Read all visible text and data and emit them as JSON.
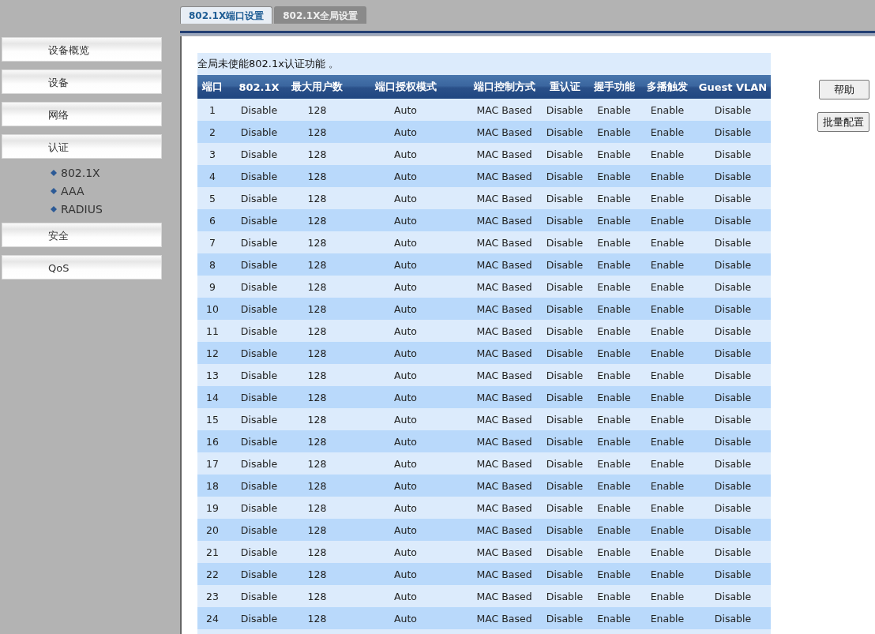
{
  "sidebar": {
    "items": [
      {
        "label": "设备概览"
      },
      {
        "label": "设备"
      },
      {
        "label": "网络"
      },
      {
        "label": "认证",
        "children": [
          {
            "label": "802.1X"
          },
          {
            "label": "AAA"
          },
          {
            "label": "RADIUS"
          }
        ]
      },
      {
        "label": "安全"
      },
      {
        "label": "QoS"
      }
    ]
  },
  "tabs": [
    {
      "label": "802.1X端口设置",
      "selected": true
    },
    {
      "label": "802.1X全局设置",
      "selected": false
    }
  ],
  "notice": "全局未使能802.1x认证功能 。",
  "table": {
    "columns": [
      "端口",
      "802.1X",
      "最大用户数",
      "端口授权模式",
      "端口控制方式",
      "重认证",
      "握手功能",
      "多播触发",
      "Guest VLAN"
    ],
    "rows": [
      [
        "1",
        "Disable",
        "128",
        "Auto",
        "MAC Based",
        "Disable",
        "Enable",
        "Enable",
        "Disable"
      ],
      [
        "2",
        "Disable",
        "128",
        "Auto",
        "MAC Based",
        "Disable",
        "Enable",
        "Enable",
        "Disable"
      ],
      [
        "3",
        "Disable",
        "128",
        "Auto",
        "MAC Based",
        "Disable",
        "Enable",
        "Enable",
        "Disable"
      ],
      [
        "4",
        "Disable",
        "128",
        "Auto",
        "MAC Based",
        "Disable",
        "Enable",
        "Enable",
        "Disable"
      ],
      [
        "5",
        "Disable",
        "128",
        "Auto",
        "MAC Based",
        "Disable",
        "Enable",
        "Enable",
        "Disable"
      ],
      [
        "6",
        "Disable",
        "128",
        "Auto",
        "MAC Based",
        "Disable",
        "Enable",
        "Enable",
        "Disable"
      ],
      [
        "7",
        "Disable",
        "128",
        "Auto",
        "MAC Based",
        "Disable",
        "Enable",
        "Enable",
        "Disable"
      ],
      [
        "8",
        "Disable",
        "128",
        "Auto",
        "MAC Based",
        "Disable",
        "Enable",
        "Enable",
        "Disable"
      ],
      [
        "9",
        "Disable",
        "128",
        "Auto",
        "MAC Based",
        "Disable",
        "Enable",
        "Enable",
        "Disable"
      ],
      [
        "10",
        "Disable",
        "128",
        "Auto",
        "MAC Based",
        "Disable",
        "Enable",
        "Enable",
        "Disable"
      ],
      [
        "11",
        "Disable",
        "128",
        "Auto",
        "MAC Based",
        "Disable",
        "Enable",
        "Enable",
        "Disable"
      ],
      [
        "12",
        "Disable",
        "128",
        "Auto",
        "MAC Based",
        "Disable",
        "Enable",
        "Enable",
        "Disable"
      ],
      [
        "13",
        "Disable",
        "128",
        "Auto",
        "MAC Based",
        "Disable",
        "Enable",
        "Enable",
        "Disable"
      ],
      [
        "14",
        "Disable",
        "128",
        "Auto",
        "MAC Based",
        "Disable",
        "Enable",
        "Enable",
        "Disable"
      ],
      [
        "15",
        "Disable",
        "128",
        "Auto",
        "MAC Based",
        "Disable",
        "Enable",
        "Enable",
        "Disable"
      ],
      [
        "16",
        "Disable",
        "128",
        "Auto",
        "MAC Based",
        "Disable",
        "Enable",
        "Enable",
        "Disable"
      ],
      [
        "17",
        "Disable",
        "128",
        "Auto",
        "MAC Based",
        "Disable",
        "Enable",
        "Enable",
        "Disable"
      ],
      [
        "18",
        "Disable",
        "128",
        "Auto",
        "MAC Based",
        "Disable",
        "Enable",
        "Enable",
        "Disable"
      ],
      [
        "19",
        "Disable",
        "128",
        "Auto",
        "MAC Based",
        "Disable",
        "Enable",
        "Enable",
        "Disable"
      ],
      [
        "20",
        "Disable",
        "128",
        "Auto",
        "MAC Based",
        "Disable",
        "Enable",
        "Enable",
        "Disable"
      ],
      [
        "21",
        "Disable",
        "128",
        "Auto",
        "MAC Based",
        "Disable",
        "Enable",
        "Enable",
        "Disable"
      ],
      [
        "22",
        "Disable",
        "128",
        "Auto",
        "MAC Based",
        "Disable",
        "Enable",
        "Enable",
        "Disable"
      ],
      [
        "23",
        "Disable",
        "128",
        "Auto",
        "MAC Based",
        "Disable",
        "Enable",
        "Enable",
        "Disable"
      ],
      [
        "24",
        "Disable",
        "128",
        "Auto",
        "MAC Based",
        "Disable",
        "Enable",
        "Enable",
        "Disable"
      ]
    ]
  },
  "buttons": [
    "帮助",
    "批量配置"
  ]
}
